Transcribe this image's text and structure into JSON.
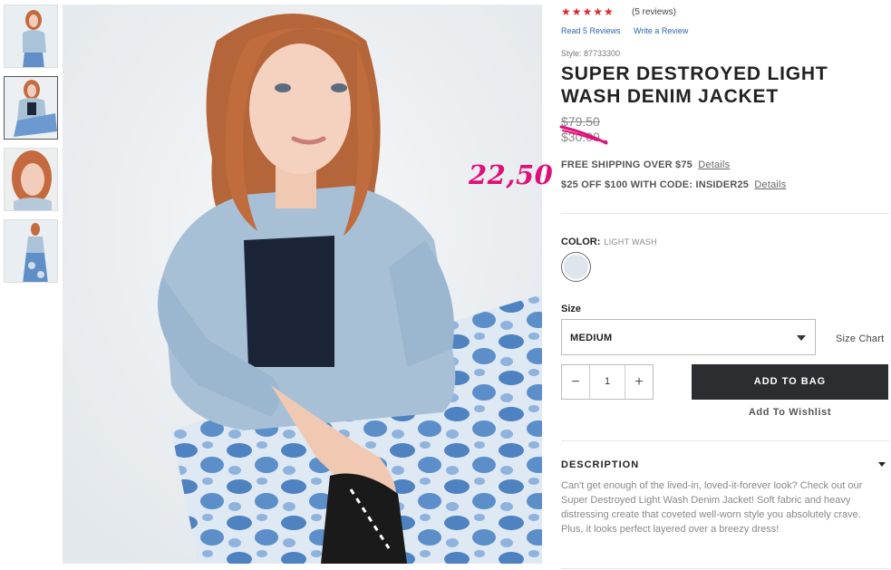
{
  "thumbnails": [
    {
      "label": "",
      "active": false
    },
    {
      "label": "",
      "active": true
    },
    {
      "label": "",
      "active": false
    },
    {
      "label": "",
      "active": false
    }
  ],
  "reviews": {
    "stars": "★★★★★",
    "count": "(5 reviews)",
    "read_link": "Read 5 Reviews",
    "write_link": "Write a Review"
  },
  "product": {
    "style": "Style: 87733300",
    "title_line1": "SUPER DESTROYED LIGHT",
    "title_line2": "WASH DENIM JACKET",
    "price_original": "$79.50",
    "price_sale": "$30.00",
    "handwritten_price": "22,50"
  },
  "promos": {
    "shipping": "FREE SHIPPING OVER $75",
    "shipping_link": "Details",
    "discount": "$25 OFF $100 WITH CODE: INSIDER25",
    "discount_link": "Details"
  },
  "color": {
    "label": "COLOR:",
    "value": "LIGHT WASH"
  },
  "size": {
    "label": "Size",
    "selected": "MEDIUM",
    "chart_link": "Size Chart"
  },
  "quantity": {
    "minus": "−",
    "value": "1",
    "plus": "+"
  },
  "actions": {
    "add_to_bag": "ADD TO BAG",
    "wishlist": "Add To Wishlist"
  },
  "description": {
    "title": "DESCRIPTION",
    "text": "Can't get enough of the lived-in, loved-it-forever look? Check out our Super Destroyed Light Wash Denim Jacket! Soft fabric and heavy distressing create that coveted well-worn style you absolutely crave. Plus, it looks perfect layered over a breezy dress!"
  },
  "colors": {
    "stars": "#e0262e",
    "link": "#2a67b0",
    "button_bg": "#2b2d30",
    "handwriting": "#e0107a"
  }
}
